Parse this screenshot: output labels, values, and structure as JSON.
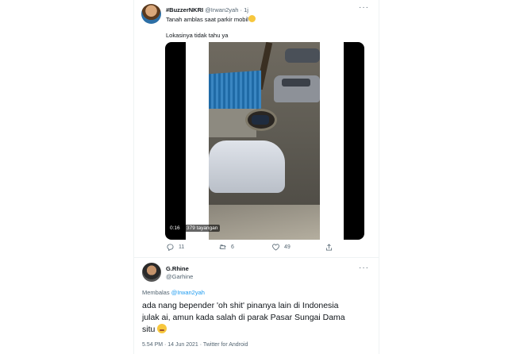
{
  "original_tweet": {
    "display_name": "#BuzzerNKRI",
    "handle": "@Irwan2yah",
    "separator": "·",
    "time": "1j",
    "text": "Tanah amblas saat parkir mobil",
    "emoji": "scream-emoji",
    "subtext": "Lokasinya tidak tahu ya",
    "video": {
      "elapsed": "0:16",
      "views": "379 tayangan"
    },
    "actions": {
      "replies": "11",
      "retweets": "6",
      "likes": "49"
    }
  },
  "reply_tweet": {
    "display_name": "G.Rhine",
    "handle": "@Garhine",
    "replying_prefix": "Membalas",
    "replying_to": "@Irwan2yah",
    "lines": [
      "ada nang bepender 'oh shit' pinanya lain di Indonesia",
      "julak ai, amun kada salah di parak Pasar Sungai Dama",
      "situ"
    ],
    "emoji": "thinking-emoji",
    "meta": "5.54 PM · 14 Jun 2021 · Twitter for Android"
  },
  "colors": {
    "text": "#0f1419",
    "muted": "#536471",
    "link": "#1d9bf0"
  }
}
